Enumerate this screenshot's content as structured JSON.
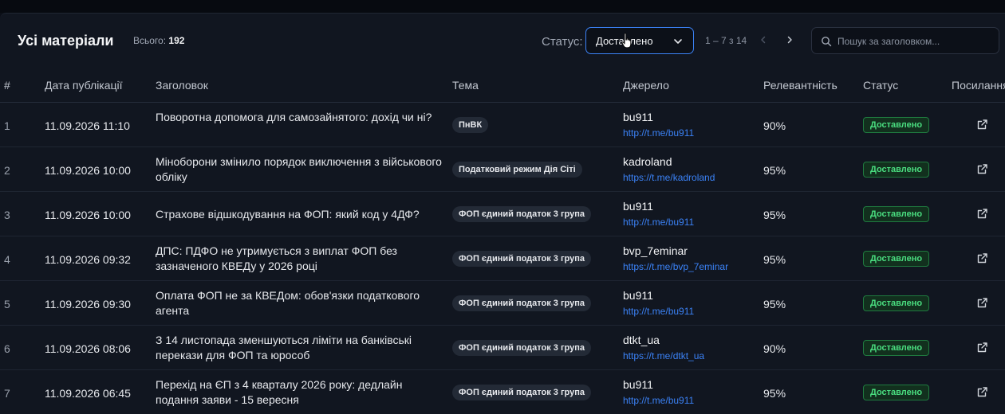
{
  "header": {
    "title": "Усі матеріали",
    "total_label": "Всього:",
    "total_value": "192",
    "status_label": "Статус:",
    "status_value": "Доставлено",
    "pager_text": "1 – 7 з 14",
    "search_placeholder": "Пошук за заголовком..."
  },
  "columns": [
    "#",
    "Дата публікації",
    "Заголовок",
    "Тема",
    "Джерело",
    "Релевантність",
    "Статус",
    "Посилання"
  ],
  "rows": [
    {
      "num": "1",
      "date": "11.09.2026 11:10",
      "title": "Поворотна допомога для самозайнятого: дохід чи ні?",
      "topic": "ПнВК",
      "source": "bu911",
      "url": "http://t.me/bu911",
      "relevance": "90%",
      "status": "Доставлено"
    },
    {
      "num": "2",
      "date": "11.09.2026 10:00",
      "title": "Міноборони змінило порядок виключення з військового обліку",
      "topic": "Податковий режим Дія Сіті",
      "source": "kadroland",
      "url": "https://t.me/kadroland",
      "relevance": "95%",
      "status": "Доставлено"
    },
    {
      "num": "3",
      "date": "11.09.2026 10:00",
      "title": "Страхове відшкодування на ФОП: який код у 4ДФ?",
      "topic": "ФОП єдиний податок 3 група",
      "source": "bu911",
      "url": "http://t.me/bu911",
      "relevance": "95%",
      "status": "Доставлено"
    },
    {
      "num": "4",
      "date": "11.09.2026 09:32",
      "title": "ДПС: ПДФО не утримується з виплат ФОП без зазначеного КВЕДу у 2026 році",
      "topic": "ФОП єдиний податок 3 група",
      "source": "bvp_7eminar",
      "url": "https://t.me/bvp_7eminar",
      "relevance": "95%",
      "status": "Доставлено"
    },
    {
      "num": "5",
      "date": "11.09.2026 09:30",
      "title": "Оплата ФОП не за КВЕДом: обов'язки податкового агента",
      "topic": "ФОП єдиний податок 3 група",
      "source": "bu911",
      "url": "http://t.me/bu911",
      "relevance": "95%",
      "status": "Доставлено"
    },
    {
      "num": "6",
      "date": "11.09.2026 08:06",
      "title": "З 14 листопада зменшуються ліміти на банківські перекази для ФОП та юрособ",
      "topic": "ФОП єдиний податок 3 група",
      "source": "dtkt_ua",
      "url": "https://t.me/dtkt_ua",
      "relevance": "90%",
      "status": "Доставлено"
    },
    {
      "num": "7",
      "date": "11.09.2026 06:45",
      "title": "Перехід на ЄП з 4 кварталу 2026 року: дедлайн подання заяви - 15 вересня",
      "topic": "ФОП єдиний податок 3 група",
      "source": "bu911",
      "url": "http://t.me/bu911",
      "relevance": "95%",
      "status": "Доставлено"
    }
  ]
}
